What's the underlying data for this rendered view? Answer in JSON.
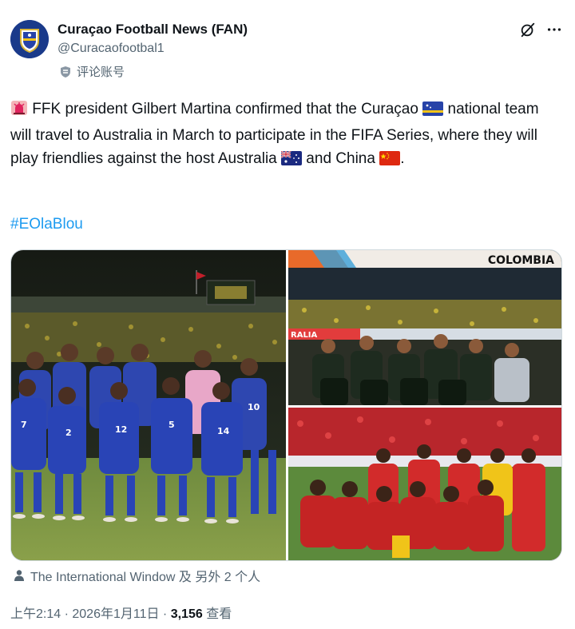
{
  "author": {
    "display_name": "Curaçao Football News (FAN)",
    "handle": "@Curacaofootbal1",
    "label": "评论账号",
    "avatar_icon": "ffk-crest-icon"
  },
  "tweet": {
    "segments": [
      {
        "type": "emoji",
        "icon": "police-light-icon"
      },
      {
        "type": "text",
        "value": " FFK president Gilbert Martina confirmed that the Curaçao "
      },
      {
        "type": "emoji",
        "icon": "curacao-flag-icon"
      },
      {
        "type": "text",
        "value": " national team will travel to Australia in March to participate in the FIFA Series, where they will play friendlies against the host Australia "
      },
      {
        "type": "emoji",
        "icon": "australia-flag-icon"
      },
      {
        "type": "text",
        "value": " and China "
      },
      {
        "type": "emoji",
        "icon": "china-flag-icon"
      },
      {
        "type": "text",
        "value": "."
      }
    ],
    "hashtag": "#EOlaBlou"
  },
  "media": {
    "photos": [
      {
        "name": "curacao-team-photo",
        "description_icon": "team-photo"
      },
      {
        "name": "australia-team-photo",
        "banner_text": "COLOMBIA",
        "board_text": "RALIA"
      },
      {
        "name": "china-team-photo"
      }
    ]
  },
  "tagged": {
    "text": "The International Window 及 另外 2 个人"
  },
  "meta": {
    "time": "上午2:14",
    "separator": " · ",
    "date": "2026年1月11日",
    "views": "3,156",
    "views_label": "查看"
  },
  "colors": {
    "accent": "#1d9bf0",
    "secondary_text": "#536471",
    "primary_text": "#0f1419",
    "curacao_blue": "#2743a8",
    "china_red": "#c8202a"
  }
}
